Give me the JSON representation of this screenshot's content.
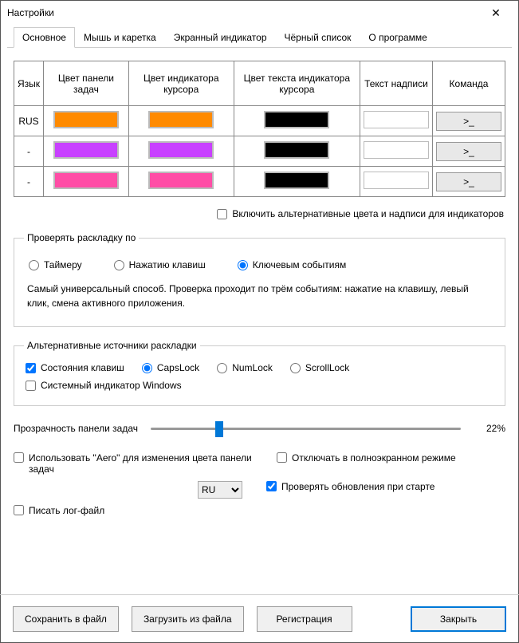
{
  "window": {
    "title": "Настройки"
  },
  "tabs": [
    "Основное",
    "Мышь и каретка",
    "Экранный индикатор",
    "Чёрный список",
    "О программе"
  ],
  "table": {
    "headers": [
      "Язык",
      "Цвет панели задач",
      "Цвет индикатора курсора",
      "Цвет текста индикатора курсора",
      "Текст надписи",
      "Команда"
    ],
    "rows": [
      {
        "lang": "RUS",
        "c1": "orange",
        "c2": "orange2",
        "c3": "black",
        "text": "",
        "cmd": ">_"
      },
      {
        "lang": "-",
        "c1": "purple",
        "c2": "purple",
        "c3": "black",
        "text": "",
        "cmd": ">_"
      },
      {
        "lang": "-",
        "c1": "pink",
        "c2": "pink",
        "c3": "black",
        "text": "",
        "cmd": ">_"
      }
    ]
  },
  "altColorsCheck": "Включить альтернативные цвета и надписи для индикаторов",
  "checkLayout": {
    "legend": "Проверять раскладку по",
    "opts": [
      "Таймеру",
      "Нажатию клавиш",
      "Ключевым событиям"
    ],
    "selected": 2,
    "desc": "Самый универсальный способ. Проверка проходит по трём событиям: нажатие на клавишу, левый клик, смена активного приложения."
  },
  "altSources": {
    "legend": "Альтернативные источники раскладки",
    "keyState": "Состояния клавиш",
    "keyOpts": [
      "CapsLock",
      "NumLock",
      "ScrollLock"
    ],
    "keySel": 0,
    "sysInd": "Системный индикатор Windows"
  },
  "slider": {
    "label": "Прозрачность панели задач",
    "value": "22%"
  },
  "opts": {
    "aero": "Использовать \"Aero\" для изменения цвета панели задач",
    "full": "Отключать в полноэкранном режиме",
    "upd": "Проверять обновления при старте",
    "log": "Писать лог-файл",
    "langSel": "RU"
  },
  "footer": {
    "save": "Сохранить в файл",
    "load": "Загрузить из файла",
    "reg": "Регистрация",
    "close": "Закрыть"
  }
}
